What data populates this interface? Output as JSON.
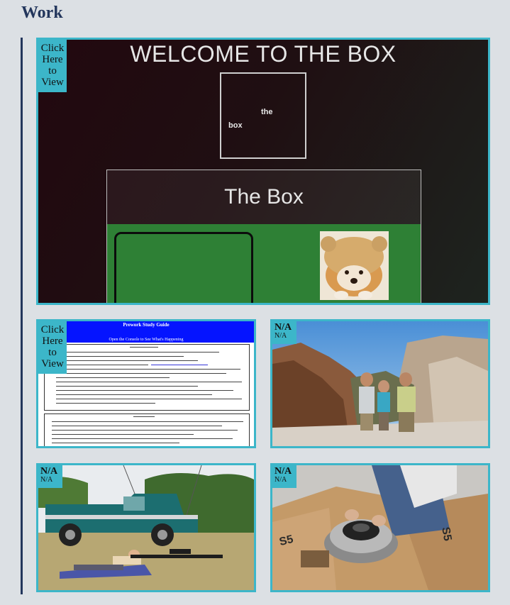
{
  "section": {
    "title": "Work"
  },
  "cards": {
    "box_site": {
      "tag": [
        "Click",
        "Here",
        "to",
        "View"
      ],
      "welcome": "WELCOME TO THE BOX",
      "logo_the": "the",
      "logo_box": "box",
      "banner": "The Box"
    },
    "study_guide": {
      "tag": [
        "Click",
        "Here",
        "to",
        "View"
      ],
      "heading": "Prework Study Guide",
      "subheading": "Open the Console to See What's Happening"
    },
    "hikers": {
      "tag_title": "N/A",
      "tag_sub": "N/A"
    },
    "rifle": {
      "tag_title": "N/A",
      "tag_sub": "N/A"
    },
    "rotor": {
      "tag_title": "N/A",
      "tag_sub": "N/A",
      "box_label_left": "S5",
      "box_label_right": "S5"
    }
  },
  "colors": {
    "accent": "#3cb6c9",
    "title": "#23365c",
    "background": "#dce0e4"
  }
}
